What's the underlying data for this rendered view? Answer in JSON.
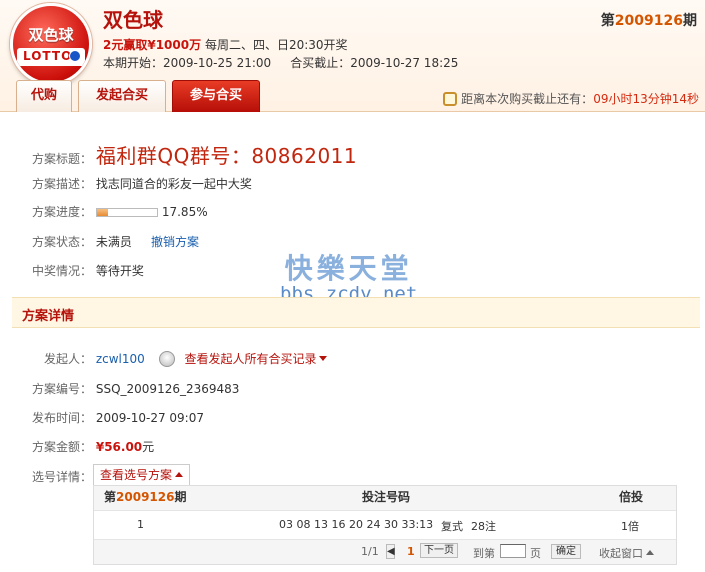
{
  "header": {
    "logo_text": "双色球",
    "logo_band": "LOTTO",
    "lottery_name": "双色球",
    "promo_prefix": "2元赢取",
    "promo_amount": "¥1000万",
    "promo_suffix": "每周二、四、日20:30开奖",
    "start_label": "本期开始：",
    "start_time": "2009-10-25 21:00",
    "end_label": "合买截止：",
    "end_time": "2009-10-27 18:25",
    "issue_prefix": "第",
    "issue_num": "2009126",
    "issue_suffix": "期"
  },
  "tabs": [
    {
      "label": "代购",
      "active": false
    },
    {
      "label": "发起合买",
      "active": false
    },
    {
      "label": "参与合买",
      "active": true
    }
  ],
  "countdown": {
    "label": "距离本次购买截止还有：",
    "time": "09小时13分钟14秒"
  },
  "plan": {
    "title_label": "方案标题：",
    "title": "福利群QQ群号：80862011",
    "desc_label": "方案描述：",
    "desc": "找志同道合的彩友一起中大奖",
    "progress_label": "方案进度：",
    "progress_pct": "17.85%",
    "progress_value": 17.85,
    "status_label": "方案状态：",
    "status": "未满员",
    "cancel_link": "撤销方案",
    "prize_label": "中奖情况：",
    "prize": "等待开奖"
  },
  "watermark": {
    "cn": "快樂天堂",
    "en": "bbs.zcdy.net"
  },
  "details": {
    "section_title": "方案详情",
    "initiator_label": "发起人：",
    "initiator": "zcwl100",
    "records_link": "查看发起人所有合买记录",
    "number_label": "方案编号：",
    "number": "SSQ_2009126_2369483",
    "time_label": "发布时间：",
    "time": "2009-10-27 09:07",
    "amount_label": "方案金额：",
    "amount": "¥56.00",
    "amount_unit": "元",
    "selection_label": "选号详情：",
    "view_btn": "查看选号方案"
  },
  "table": {
    "h_prefix": "第",
    "h_issue": "2009126",
    "h_suffix": "期",
    "h_numbers": "投注号码",
    "h_multiple": "倍投",
    "row_index": "1",
    "row_numbers": "03 08 13 16 20 24 30 33:13",
    "row_type": "复式",
    "row_count": "28注",
    "row_multiple": "1倍"
  },
  "pager": {
    "page_info": "1/1",
    "current": "1",
    "next": "下一页",
    "goto_prefix": "到第",
    "goto_suffix": "页",
    "confirm": "确定",
    "collapse": "收起窗口"
  }
}
